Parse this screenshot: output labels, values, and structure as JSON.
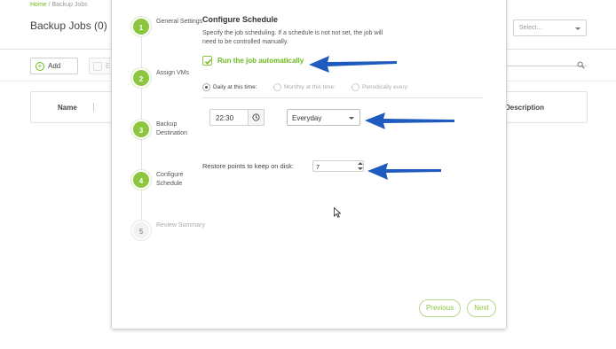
{
  "background": {
    "breadcrumb": {
      "home": "Home",
      "separator": " / ",
      "current": "Backup Jobs"
    },
    "page_title": "Backup Jobs (0)",
    "select_placeholder": "Select...",
    "toolbar": {
      "add_label": "Add",
      "edit_label": "E"
    },
    "table": {
      "columns": [
        "Name",
        "Description"
      ]
    }
  },
  "wizard": {
    "steps": [
      {
        "number": "1",
        "label": "General Settings",
        "state": "done"
      },
      {
        "number": "2",
        "label": "Assign VMs",
        "state": "done"
      },
      {
        "number": "3",
        "label": "Backup Destination",
        "state": "done"
      },
      {
        "number": "4",
        "label": "Configure Schedule",
        "state": "current"
      },
      {
        "number": "5",
        "label": "Review Summary",
        "state": "pending"
      }
    ],
    "section_title": "Configure Schedule",
    "description": "Specify the job scheduling. If a schedule is not not set, the job will need to be controlled manually.",
    "run_auto": {
      "label": "Run the job automatically",
      "checked": true
    },
    "schedule_options": [
      {
        "label": "Daily at this time:",
        "selected": true
      },
      {
        "label": "Monthly at this time:",
        "selected": false
      },
      {
        "label": "Periodically every:",
        "selected": false
      }
    ],
    "time_value": "22:30",
    "frequency_value": "Everyday",
    "restore_points": {
      "label": "Restore points to keep on disk:",
      "value": "7"
    },
    "buttons": {
      "previous": "Previous",
      "next": "Next"
    }
  },
  "colors": {
    "accent": "#8cc63f",
    "accent_text": "#6cba1a",
    "annotation_arrow": "#1f5bbf"
  },
  "icons": [
    "check-icon",
    "clock-icon",
    "chevron-down-icon",
    "search-icon",
    "plus-icon",
    "edit-icon",
    "mouse-cursor-icon",
    "annotation-arrow-icon"
  ]
}
